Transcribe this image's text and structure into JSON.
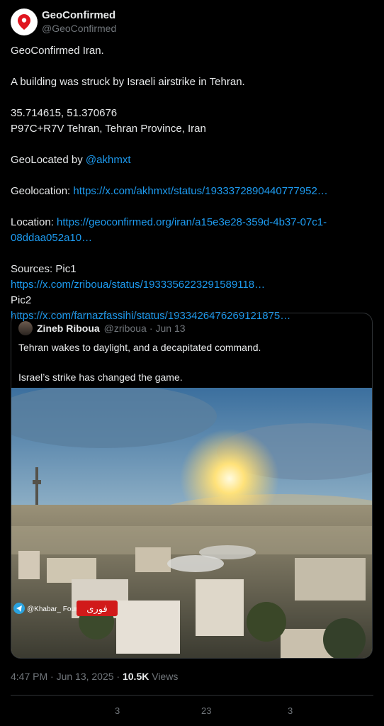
{
  "author": {
    "display_name": "GeoConfirmed",
    "handle": "@GeoConfirmed",
    "avatar_icon": "map-pin-icon"
  },
  "tweet": {
    "line1": "GeoConfirmed Iran.",
    "line2": "A building was struck by Israeli airstrike in Tehran.",
    "coords": "35.714615, 51.370676",
    "plus_code": "P97C+R7V Tehran, Tehran Province, Iran",
    "geolocated_label": "GeoLocated by ",
    "geolocated_user": "@akhmxt",
    "geolocation_label": "Geolocation: ",
    "geolocation_url": "https://x.com/akhmxt/status/1933372890440777952…",
    "location_label": "Location: ",
    "location_url_1": "https://geoconfirmed.org/iran/a15e3e28-359d-4b37-07c1-",
    "location_url_2": "08ddaa052a10…",
    "sources_label": "Sources: Pic1",
    "pic1_url": "https://x.com/zriboua/status/1933356223291589118…",
    "pic2_label": "Pic2",
    "pic2_url": "https://x.com/farnazfassihi/status/1933426476269121875…"
  },
  "quote": {
    "name": "Zineb Riboua",
    "handle": "@zriboua",
    "separator": "·",
    "date": "Jun 13",
    "text1": "Tehran wakes to daylight, and a decapitated command.",
    "text2": "Israel’s strike has changed the game.",
    "image_watermark": "@Khabar_ Fouri",
    "watermark_logo": "فوری"
  },
  "meta": {
    "time": "4:47 PM · Jun 13, 2025 · ",
    "views_count": "10.5K",
    "views_label": " Views"
  },
  "actions": {
    "replies": "3",
    "reposts": "23",
    "likes": "3"
  }
}
